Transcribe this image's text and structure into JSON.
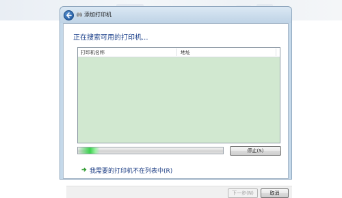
{
  "window": {
    "title": "添加打印机"
  },
  "main": {
    "heading": "正在搜索可用的打印机...",
    "columns": [
      "打印机名称",
      "地址"
    ],
    "progress": 0.15,
    "stop_label": "停止(S)",
    "not_listed_link": "我需要的打印机不在列表中(R)"
  },
  "footer": {
    "next_label": "下一步(N)",
    "cancel_label": "取消"
  },
  "colors": {
    "list_background": "#d1e8d0",
    "heading": "#1a3f8a",
    "progress_fill": "#3bd34e"
  },
  "icons": [
    "back-arrow-icon",
    "printer-icon",
    "green-arrow-icon"
  ]
}
